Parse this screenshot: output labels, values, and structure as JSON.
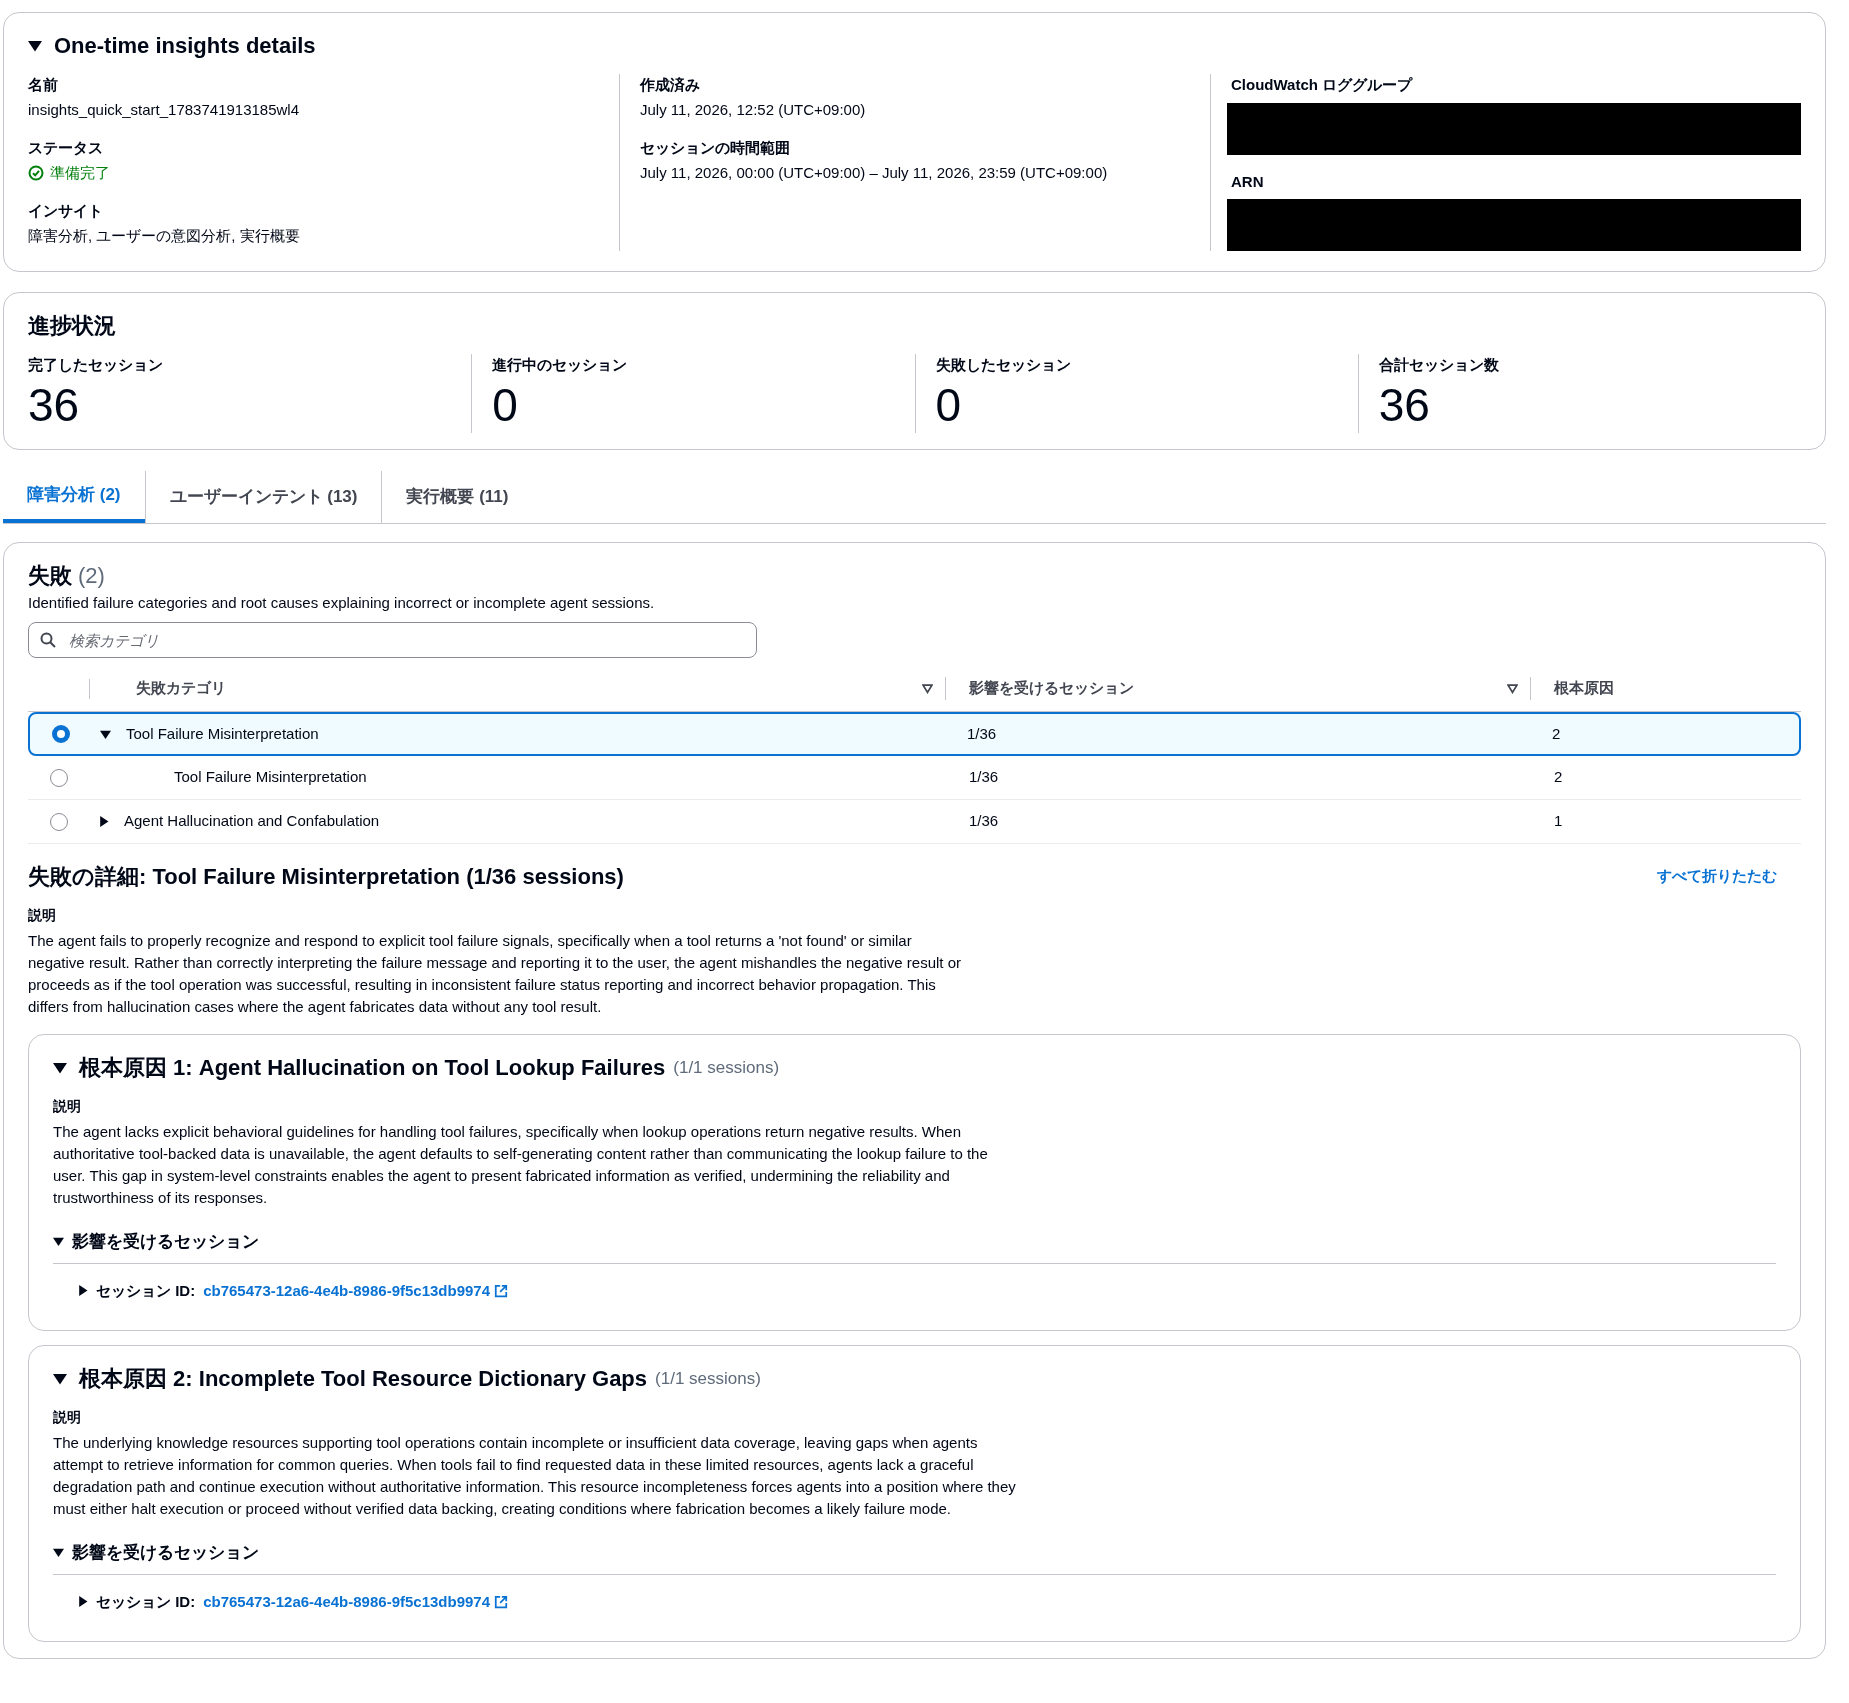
{
  "details": {
    "title": "One-time insights details",
    "expanded": true,
    "columns": [
      [
        {
          "label": "名前",
          "kind": "text",
          "value": "insights_quick_start_1783741913185wl4"
        },
        {
          "label": "ステータス",
          "kind": "status",
          "value": "準備完了"
        },
        {
          "label": "インサイト",
          "kind": "text",
          "value": "障害分析, ユーザーの意図分析, 実行概要"
        }
      ],
      [
        {
          "label": "作成済み",
          "kind": "text",
          "value": "July 11, 2026, 12:52 (UTC+09:00)"
        },
        {
          "label": "セッションの時間範囲",
          "kind": "text",
          "value": "July 11, 2026, 00:00 (UTC+09:00) – July 11, 2026, 23:59 (UTC+09:00)"
        }
      ],
      [
        {
          "label": "CloudWatch ロググループ",
          "kind": "redacted"
        },
        {
          "label": "ARN",
          "kind": "redacted"
        }
      ]
    ]
  },
  "progress": {
    "title": "進捗状況",
    "stats": [
      {
        "label": "完了したセッション",
        "value": "36"
      },
      {
        "label": "進行中のセッション",
        "value": "0"
      },
      {
        "label": "失敗したセッション",
        "value": "0"
      },
      {
        "label": "合計セッション数",
        "value": "36"
      }
    ]
  },
  "tabs": [
    {
      "label": "障害分析 (2)",
      "selected": true
    },
    {
      "label": "ユーザーインテント (13)",
      "selected": false
    },
    {
      "label": "実行概要 (11)",
      "selected": false
    }
  ],
  "failures": {
    "title": "失敗",
    "count": "(2)",
    "description": "Identified failure categories and root causes explaining incorrect or incomplete agent sessions.",
    "search": {
      "placeholder": "検索カテゴリ"
    },
    "table": {
      "columns": [
        {
          "label": "失敗カテゴリ",
          "sortable": true
        },
        {
          "label": "影響を受けるセッション",
          "sortable": true
        },
        {
          "label": "根本原因",
          "sortable": false
        }
      ],
      "rows": [
        {
          "category": "Tool Failure Misinterpretation",
          "sessions": "1/36",
          "root_causes": "2",
          "selected": true,
          "expanded": true,
          "children": [
            {
              "category": "Tool Failure Misinterpretation",
              "sessions": "1/36",
              "root_causes": "2",
              "selected": false
            }
          ]
        },
        {
          "category": "Agent Hallucination and Confabulation",
          "sessions": "1/36",
          "root_causes": "1",
          "selected": false,
          "expanded": false
        }
      ]
    },
    "detail": {
      "title": "失敗の詳細: Tool Failure Misinterpretation (1/36 sessions)",
      "collapse_link": "すべて折りたたむ",
      "description_label": "説明",
      "description": "The agent fails to properly recognize and respond to explicit tool failure signals, specifically when a tool returns a 'not found' or similar negative result. Rather than correctly interpreting the failure message and reporting it to the user, the agent mishandles the negative result or proceeds as if the tool operation was successful, resulting in inconsistent failure status reporting and incorrect behavior propagation. This differs from hallucination cases where the agent fabricates data without any tool result.",
      "root_causes": [
        {
          "title": "根本原因 1: Agent Hallucination on Tool Lookup Failures",
          "count": "(1/1 sessions)",
          "expanded": true,
          "description_label": "説明",
          "description": "The agent lacks explicit behavioral guidelines for handling tool failures, specifically when lookup operations return negative results. When authoritative tool-backed data is unavailable, the agent defaults to self-generating content rather than communicating the lookup failure to the user. This gap in system-level constraints enables the agent to present fabricated information as verified, undermining the reliability and trustworthiness of its responses.",
          "sessions": {
            "title": "影響を受けるセッション",
            "expanded": true,
            "items": [
              {
                "label": "セッション ID:",
                "id": "cb765473-12a6-4e4b-8986-9f5c13db9974",
                "expanded": false
              }
            ]
          }
        },
        {
          "title": "根本原因 2: Incomplete Tool Resource Dictionary Gaps",
          "count": "(1/1 sessions)",
          "expanded": true,
          "description_label": "説明",
          "description": "The underlying knowledge resources supporting tool operations contain incomplete or insufficient data coverage, leaving gaps when agents attempt to retrieve information for common queries. When tools fail to find requested data in these limited resources, agents lack a graceful degradation path and continue execution without authoritative information. This resource incompleteness forces agents into a position where they must either halt execution or proceed without verified data backing, creating conditions where fabrication becomes a likely failure mode.",
          "sessions": {
            "title": "影響を受けるセッション",
            "expanded": true,
            "items": [
              {
                "label": "セッション ID:",
                "id": "cb765473-12a6-4e4b-8986-9f5c13db9974",
                "expanded": false
              }
            ]
          }
        }
      ]
    }
  }
}
